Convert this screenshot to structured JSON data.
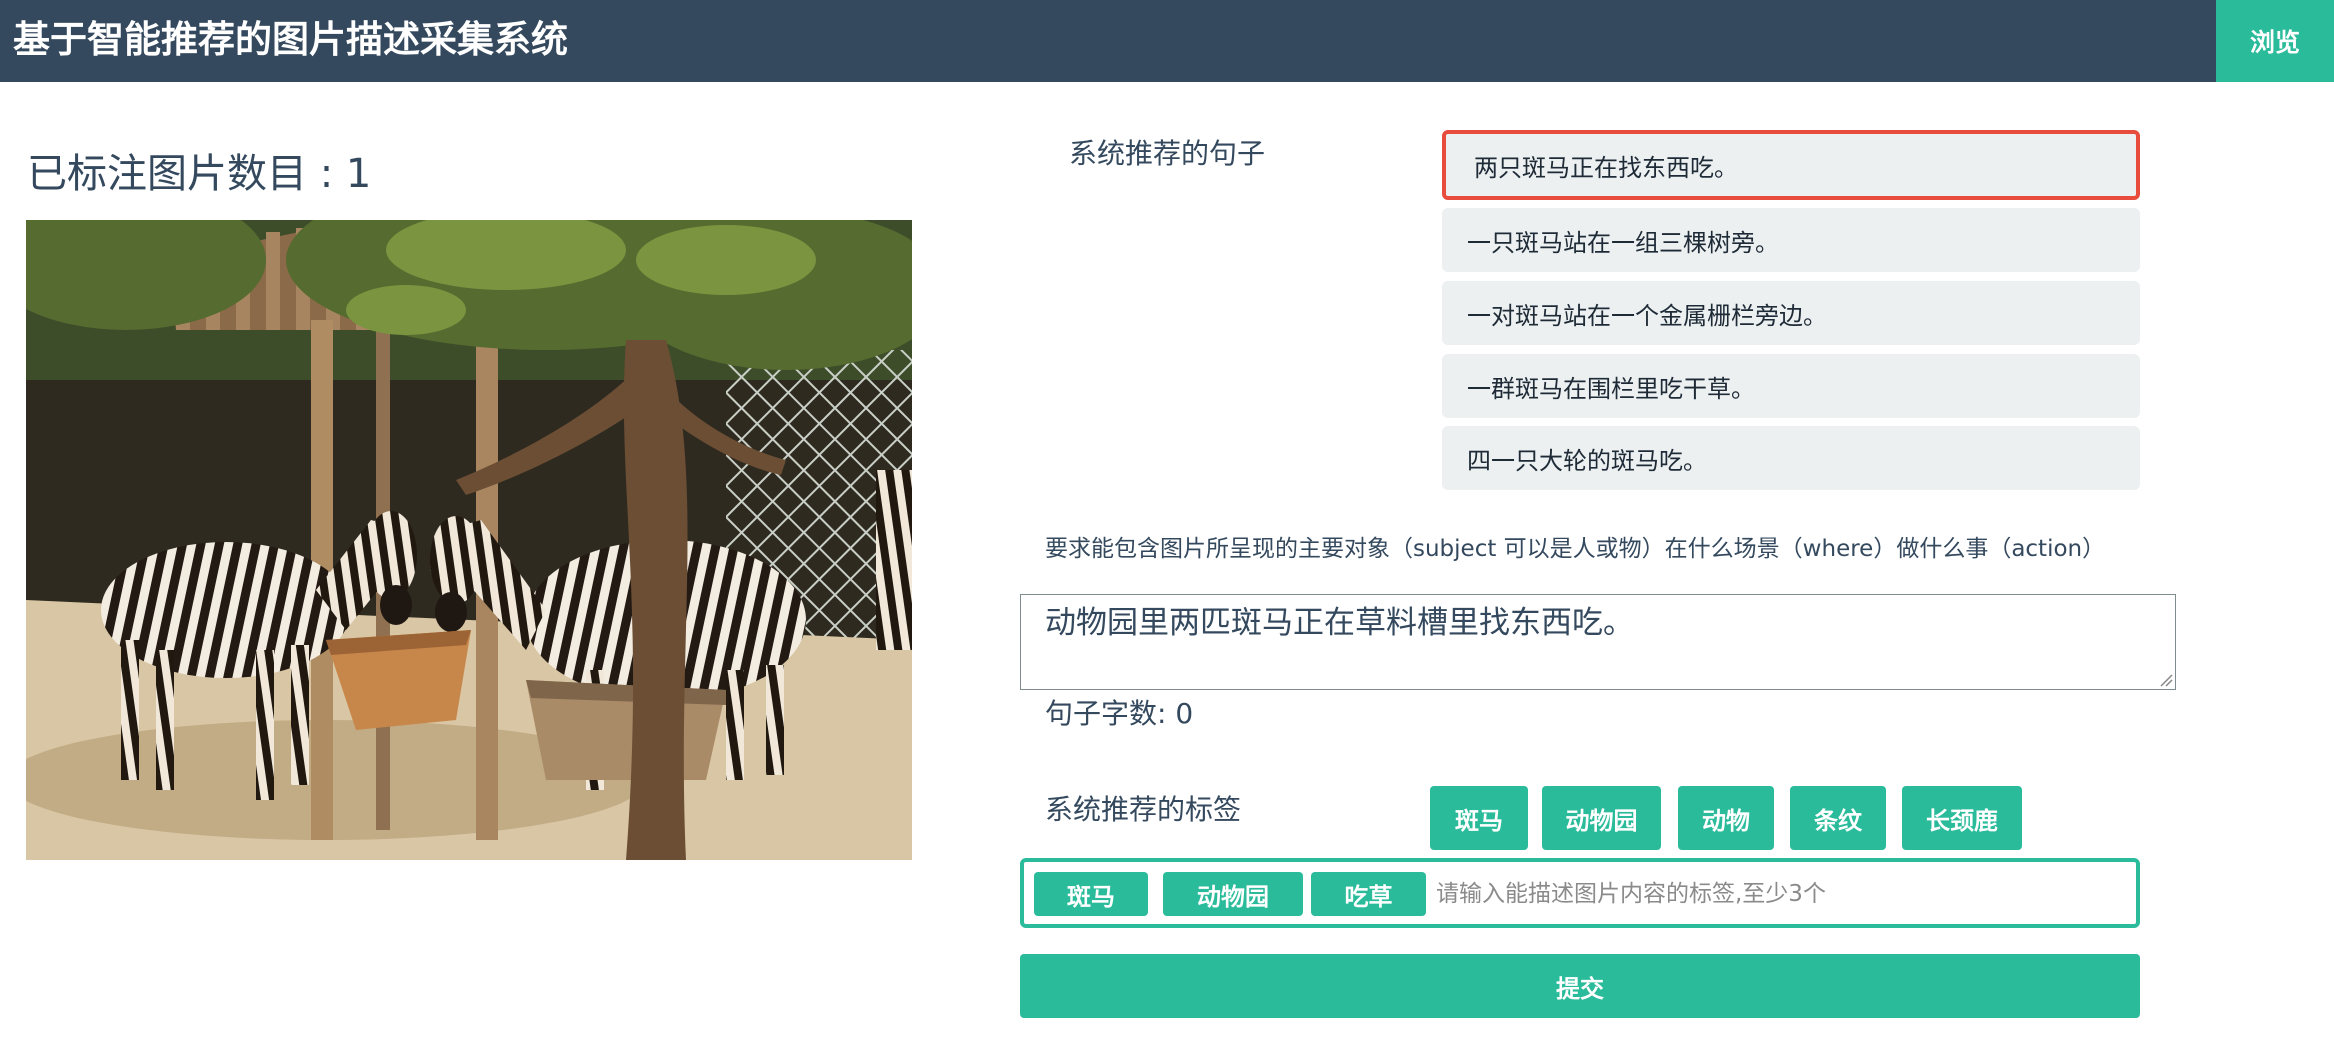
{
  "header": {
    "title": "基于智能推荐的图片描述采集系统",
    "browse_label": "浏览"
  },
  "stats": {
    "annotated_count_label": "已标注图片数目 : 1"
  },
  "image": {
    "subject": "zebras at a wooden feeding trough in a zoo enclosure"
  },
  "recommended_sentences": {
    "title": "系统推荐的句子",
    "items": [
      "两只斑马正在找东西吃。",
      "一只斑马站在一组三棵树旁。",
      "一对斑马站在一个金属栅栏旁边。",
      "一群斑马在围栏里吃干草。",
      "四一只大轮的斑马吃。"
    ],
    "selected_index": 0
  },
  "description": {
    "hint": "要求能包含图片所呈现的主要对象（subject 可以是人或物）在什么场景（where）做什么事（action）",
    "value": "动物园里两匹斑马正在草料槽里找东西吃。",
    "char_count_label": "句子字数: 0"
  },
  "recommended_tags": {
    "title": "系统推荐的标签",
    "items": [
      "斑马",
      "动物园",
      "动物",
      "条纹",
      "长颈鹿"
    ]
  },
  "tag_input": {
    "chosen": [
      "斑马",
      "动物园",
      "吃草"
    ],
    "placeholder": "请输入能描述图片内容的标签,至少3个"
  },
  "submit_label": "提交",
  "colors": {
    "navbar": "#34495e",
    "accent": "#2abb9b",
    "selected_border": "#e74c3c",
    "sentence_bg": "#ecf0f1"
  }
}
